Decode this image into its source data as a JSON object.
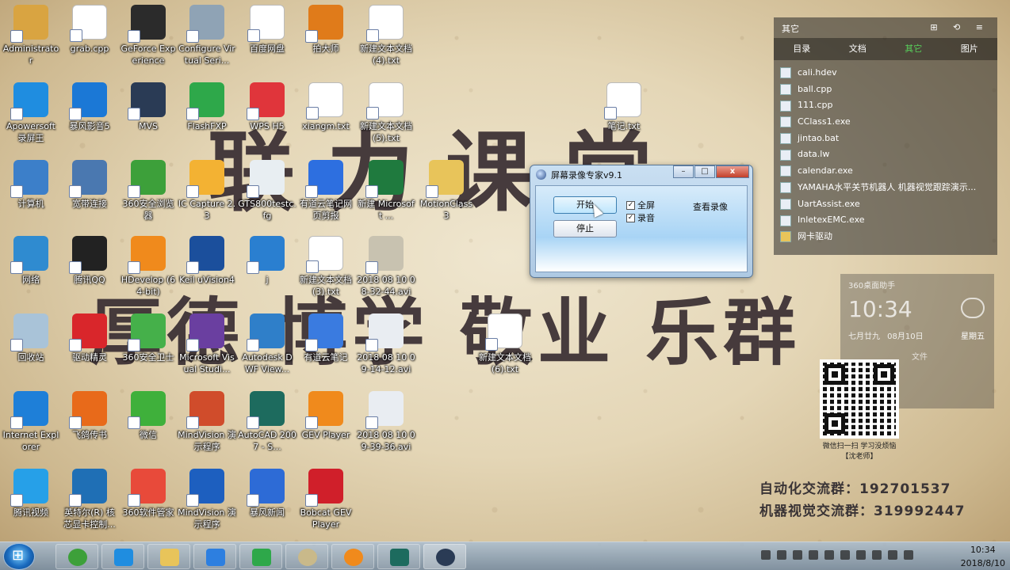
{
  "desktop": {
    "watermark_line1": "联力课堂",
    "watermark_line2": "厚德 博学 敬业 乐群",
    "icons": [
      {
        "label": "Administrator",
        "color": "#d9a441"
      },
      {
        "label": "grab.cpp",
        "color": "#ffffff"
      },
      {
        "label": "GeForce Experience",
        "color": "#2b2b2b"
      },
      {
        "label": "Configure Virtual Seri...",
        "color": "#8fa3b5"
      },
      {
        "label": "百度网盘",
        "color": "#ffffff"
      },
      {
        "label": "拍大师",
        "color": "#e07b1a"
      },
      {
        "label": "新建文本文档 (4).txt",
        "color": "#ffffff"
      },
      {
        "label": "Apowersoft 录屏王",
        "color": "#1f8de0"
      },
      {
        "label": "暴风影音5",
        "color": "#1b78d6"
      },
      {
        "label": "MVS",
        "color": "#2a3b55"
      },
      {
        "label": "FlashFXP",
        "color": "#2ea84a"
      },
      {
        "label": "WPS H5",
        "color": "#e0353b"
      },
      {
        "label": "xiangm.txt",
        "color": "#ffffff"
      },
      {
        "label": "新建文本文档 (5).txt",
        "color": "#ffffff"
      },
      {
        "label": "笔记.txt",
        "color": "#ffffff"
      },
      {
        "label": "计算机",
        "color": "#3c7fc9"
      },
      {
        "label": "宽带连接",
        "color": "#4a78b0"
      },
      {
        "label": "360安全浏览器",
        "color": "#3da03a"
      },
      {
        "label": "IC Capture 2.3",
        "color": "#f3b233"
      },
      {
        "label": "GTS800testc.fg",
        "color": "#e8eef2"
      },
      {
        "label": "有道云笔记网页剪报",
        "color": "#2d6fe0"
      },
      {
        "label": "新建 Microsoft ...",
        "color": "#1f7a3e"
      },
      {
        "label": "MotionClass 3",
        "color": "#e8c45a"
      },
      {
        "label": "网络",
        "color": "#2f8bd0"
      },
      {
        "label": "腾讯QQ",
        "color": "#222222"
      },
      {
        "label": "HDevelop (64-bit)",
        "color": "#f08a1c"
      },
      {
        "label": "Keil uVision4",
        "color": "#1b4f9c"
      },
      {
        "label": "j",
        "color": "#2a7fd0"
      },
      {
        "label": "新建文本文档 (3).txt",
        "color": "#ffffff"
      },
      {
        "label": "2018 08 10 08-32-44.avi",
        "color": "#c8c2b0"
      },
      {
        "label": "回收站",
        "color": "#a9c3d8"
      },
      {
        "label": "驱动精灵",
        "color": "#d9262b"
      },
      {
        "label": "360安全卫士",
        "color": "#45b04a"
      },
      {
        "label": "Microsoft Visual Studi...",
        "color": "#6a3fa0"
      },
      {
        "label": "Autodesk DWF View...",
        "color": "#2f7fc9"
      },
      {
        "label": "有道云笔记",
        "color": "#3a7be0"
      },
      {
        "label": "2018 08 10 09-14-12.avi",
        "color": "#e9edf2"
      },
      {
        "label": "新建文本文档 (6).txt",
        "color": "#ffffff"
      },
      {
        "label": "Internet Explorer",
        "color": "#1e7fd8"
      },
      {
        "label": "飞鸽传书",
        "color": "#e86a1a"
      },
      {
        "label": "微信",
        "color": "#3fb03b"
      },
      {
        "label": "MindVision 演示程序",
        "color": "#d04c2b"
      },
      {
        "label": "AutoCAD 2007 - S...",
        "color": "#1d6b5e"
      },
      {
        "label": "GEV Player",
        "color": "#f08a1c"
      },
      {
        "label": "2018 08 10 09-39-36.avi",
        "color": "#e9edf2"
      },
      {
        "label": "腾讯视频",
        "color": "#26a0e8"
      },
      {
        "label": "英特尔(R) 核芯显卡控制...",
        "color": "#1f6fb5"
      },
      {
        "label": "360软件管家",
        "color": "#e84a3a"
      },
      {
        "label": "MindVision 演示程序",
        "color": "#1d5fbf"
      },
      {
        "label": "暴风新闻",
        "color": "#2d6bd6"
      },
      {
        "label": "Bobcat GEV Player",
        "color": "#d01f2a"
      }
    ]
  },
  "recorder": {
    "title": "屏幕录像专家v9.1",
    "start_label": "开始",
    "stop_label": "停止",
    "fullscreen_label": "全屏",
    "audio_label": "录音",
    "fullscreen_checked": "✓",
    "audio_checked": "✓",
    "view_label": "查看录像",
    "minimize": "–",
    "maximize": "□",
    "close": "x"
  },
  "fence": {
    "title": "其它",
    "tools": "⊞ ⟲ ≡",
    "tabs": [
      "目录",
      "文档",
      "其它",
      "图片"
    ],
    "files": [
      "cali.hdev",
      "ball.cpp",
      "111.cpp",
      "CClass1.exe",
      "jintao.bat",
      "data.lw",
      "calendar.exe",
      "YAMAHA水平关节机器人 机器视觉跟踪演示...",
      "UartAssist.exe",
      "InletexEMC.exe",
      "网卡驱动"
    ]
  },
  "widget": {
    "title": "360桌面助手",
    "time": "10:34",
    "date": "七月廿九 08月10日",
    "weekday": "星期五",
    "files_label": "文件"
  },
  "qr": {
    "caption_line1": "微信扫一扫 学习没烦恼",
    "caption_line2": "【沈老师】"
  },
  "groups": {
    "automation": "自动化交流群：192701537",
    "vision": "机器视觉交流群：319992447"
  },
  "taskbar": {
    "apps": [
      "360浏览器",
      "录屏",
      "资源管理器",
      "WPS",
      "Excel",
      "画图",
      "HDevelop",
      "AutoCAD",
      "MVS"
    ],
    "time": "10:34",
    "date": "2018/8/10"
  }
}
